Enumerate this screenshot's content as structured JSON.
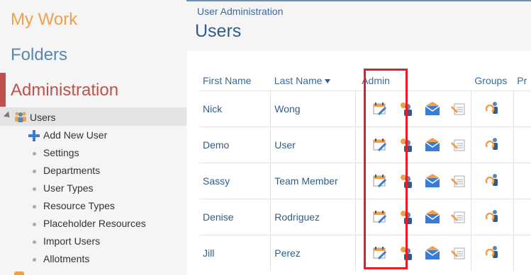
{
  "sidebar": {
    "my_work": "My Work",
    "folders": "Folders",
    "administration": "Administration",
    "users": "Users",
    "add_new_user": "Add New User",
    "items": [
      "Settings",
      "Departments",
      "User Types",
      "Resource Types",
      "Placeholder Resources",
      "Import Users",
      "Allotments"
    ]
  },
  "breadcrumb": "User Administration",
  "page_title": "Users",
  "table": {
    "headers": {
      "first": "First Name",
      "last": "Last Name",
      "admin": "Admin",
      "groups": "Groups",
      "pr": "Pr"
    },
    "rows": [
      {
        "first": "Nick",
        "last": "Wong"
      },
      {
        "first": "Demo",
        "last": "User"
      },
      {
        "first": "Sassy",
        "last": "Team Member"
      },
      {
        "first": "Denise",
        "last": "Rodriguez"
      },
      {
        "first": "Jill",
        "last": "Perez"
      }
    ]
  },
  "colors": {
    "highlight": "#e31e24",
    "admin": "#c0504d",
    "mywork": "#f0a04b",
    "folders": "#5b86ad"
  }
}
